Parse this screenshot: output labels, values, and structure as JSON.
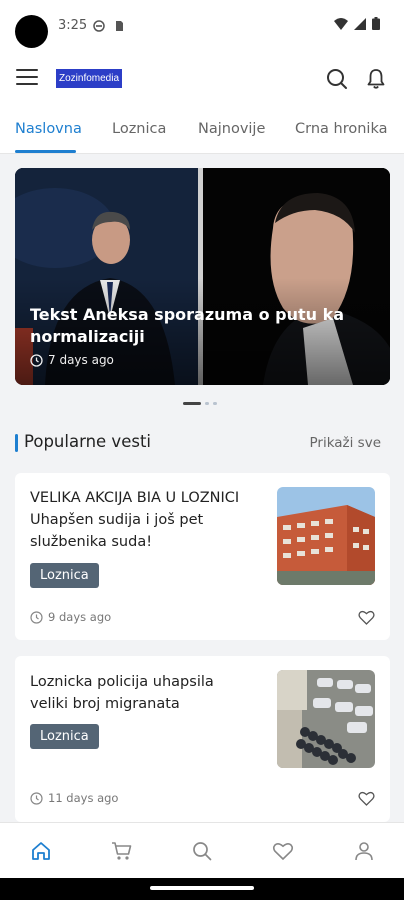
{
  "status_bar": {
    "time": "3:25"
  },
  "app": {
    "logo_text": "Zozinfomedia"
  },
  "tabs": [
    {
      "label": "Naslovna",
      "active": true
    },
    {
      "label": "Loznica",
      "active": false
    },
    {
      "label": "Najnovije",
      "active": false
    },
    {
      "label": "Crna hronika",
      "active": false
    }
  ],
  "featured": {
    "title": "Tekst Aneksa sporazuma o putu ka normalizaciji",
    "time": "7 days ago",
    "slide_count": 3,
    "active_slide": 1
  },
  "popular": {
    "title": "Popularne vesti",
    "see_all": "Prikaži sve",
    "articles": [
      {
        "title": "VELIKA AKCIJA BIA U LOZNICI Uhapšen sudija i još pet službenika suda!",
        "category": "Loznica",
        "time": "9 days ago",
        "thumbnail_icon": "building-photo"
      },
      {
        "title": "Loznicka policija uhapsila veliki broj migranata",
        "category": "Loznica",
        "time": "11 days ago",
        "thumbnail_icon": "parking-lot-photo"
      }
    ]
  },
  "bottom_nav": [
    {
      "icon": "home-icon",
      "active": true
    },
    {
      "icon": "cart-icon",
      "active": false
    },
    {
      "icon": "search-icon",
      "active": false
    },
    {
      "icon": "heart-icon",
      "active": false
    },
    {
      "icon": "profile-icon",
      "active": false
    }
  ],
  "colors": {
    "accent": "#1e7fd0",
    "logo_bg": "#2c3ec7",
    "chip_bg": "#546575",
    "page_bg": "#f2f3f5"
  }
}
